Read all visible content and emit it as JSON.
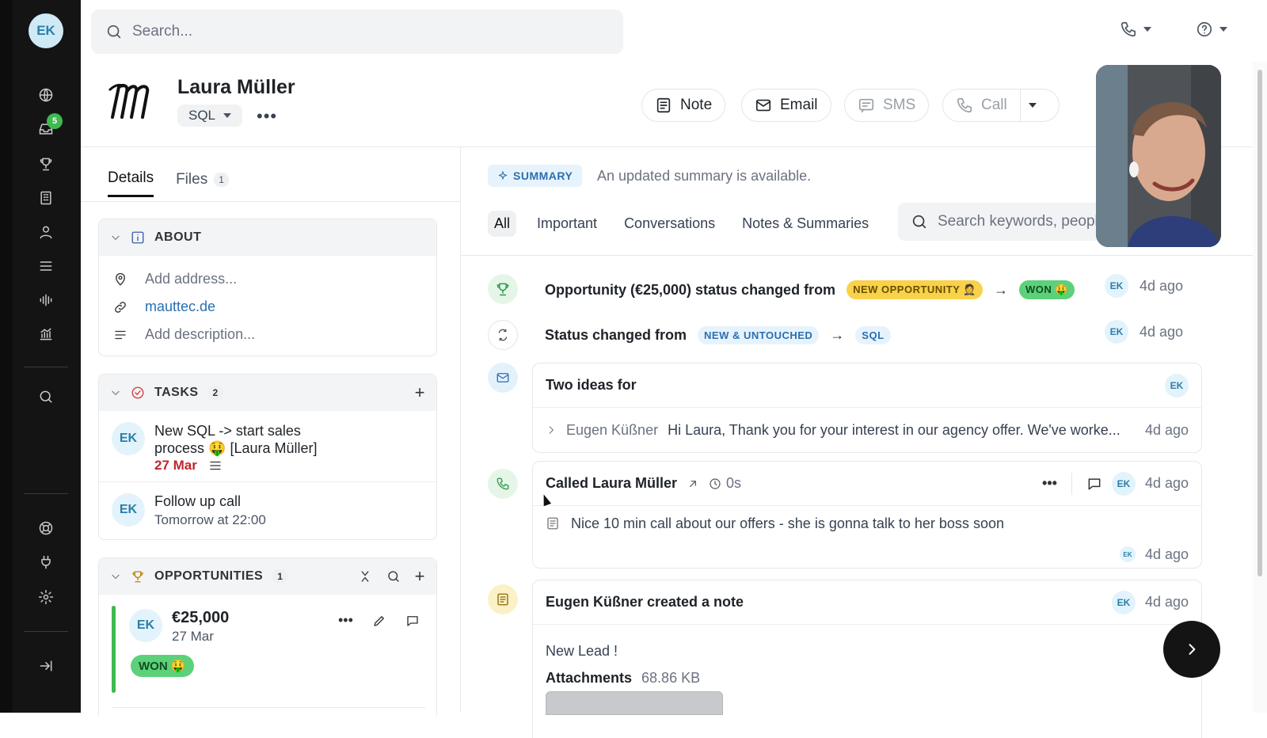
{
  "user": {
    "initials": "EK"
  },
  "sidebar": {
    "inbox_badge": "5"
  },
  "search": {
    "placeholder": "Search..."
  },
  "lead": {
    "name": "Laura Müller",
    "stage": "SQL"
  },
  "actions": {
    "note": "Note",
    "email": "Email",
    "sms": "SMS",
    "call": "Call"
  },
  "left_tabs": [
    {
      "label": "Details"
    },
    {
      "label": "Files",
      "count": "1"
    }
  ],
  "about": {
    "title": "ABOUT",
    "address_placeholder": "Add address...",
    "website": "mauttec.de",
    "description_placeholder": "Add description..."
  },
  "tasks": {
    "title": "TASKS",
    "count": "2",
    "items": [
      {
        "avatar": "EK",
        "title": "New SQL -> start sales process 🤑 [Laura Müller]",
        "due": "27 Mar"
      },
      {
        "avatar": "EK",
        "title": "Follow up call",
        "due": "Tomorrow at 22:00"
      }
    ]
  },
  "opportunities": {
    "title": "OPPORTUNITIES",
    "count": "1",
    "item": {
      "avatar": "EK",
      "amount": "€25,000",
      "date": "27 Mar",
      "status": "WON 🤑"
    }
  },
  "summary": {
    "label": "SUMMARY",
    "text": "An updated summary is available."
  },
  "filters": [
    "All",
    "Important",
    "Conversations",
    "Notes & Summaries"
  ],
  "keyword_search": {
    "placeholder": "Search keywords, people..."
  },
  "timeline": {
    "opportunity_change": {
      "text": "Opportunity (€25,000) status changed from",
      "from": "NEW OPPORTUNITY 🤵",
      "to": "WON 🤑",
      "avatar": "EK",
      "time": "4d ago"
    },
    "status_change": {
      "text": "Status changed from",
      "from": "NEW & UNTOUCHED",
      "to": "SQL",
      "avatar": "EK",
      "time": "4d ago"
    },
    "email": {
      "subject": "Two ideas for",
      "avatar": "EK",
      "sender": "Eugen Küßner",
      "preview": "Hi Laura, Thank you for your interest in our agency offer. We've worke...",
      "time": "4d ago"
    },
    "call": {
      "title": "Called Laura Müller",
      "duration": "0s",
      "avatar": "EK",
      "time": "4d ago",
      "note": "Nice 10 min call about our offers - she is gonna talk to her boss soon",
      "note_avatar": "EK",
      "note_time": "4d ago"
    },
    "note": {
      "title": "Eugen Küßner created a note",
      "avatar": "EK",
      "time": "4d ago",
      "body": "New Lead !",
      "attachments_label": "Attachments",
      "attachments_size": "68.86 KB"
    }
  },
  "colors": {
    "accent": "#2a6fb0",
    "green": "#3fb950",
    "yellow": "#f5c518",
    "due_red": "#c0262d"
  }
}
